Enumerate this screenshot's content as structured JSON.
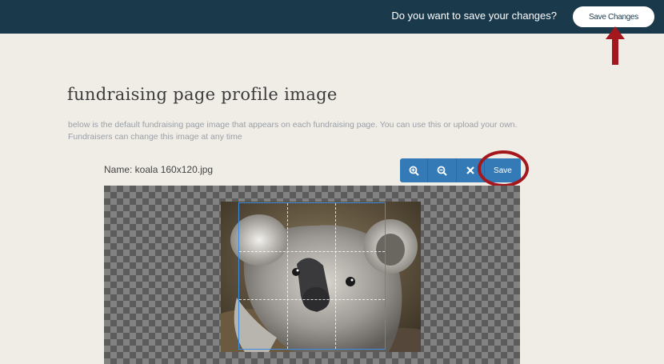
{
  "topbar": {
    "question": "Do you want to save your changes?",
    "save_changes_label": "Save Changes"
  },
  "section": {
    "title": "fundraising page profile image",
    "description": "below is the default fundraising page image that appears on each fundraising page. You can use this or upload your own. Fundraisers can change this image at any time"
  },
  "editor": {
    "file_name": "Name: koala 160x120.jpg",
    "tools": [
      {
        "icon": "zoom-in-icon",
        "symbol": "⊕"
      },
      {
        "icon": "zoom-out-icon",
        "symbol": "⊖"
      },
      {
        "icon": "close-icon",
        "symbol": "✖"
      }
    ],
    "save_label": "Save"
  },
  "colors": {
    "topbar": "#1a3a4c",
    "button_blue": "#337ab7",
    "annotation_red": "#a4171d",
    "background": "#f0ede7"
  }
}
